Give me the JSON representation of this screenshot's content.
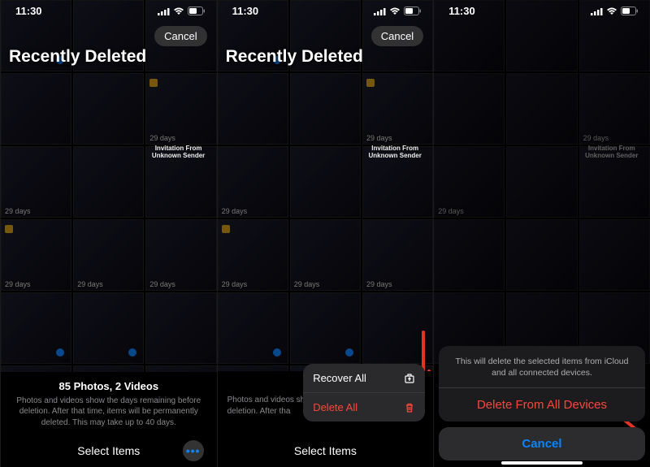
{
  "status": {
    "time": "11:30"
  },
  "header": {
    "title": "Recently Deleted",
    "cancel": "Cancel"
  },
  "grid": {
    "days_label": "29 days",
    "invitation_title": "Invitation From Unknown Sender"
  },
  "footer": {
    "summary_title": "85 Photos, 2 Videos",
    "summary_text": "Photos and videos show the days remaining before deletion. After that time, items will be permanently deleted. This may take up to 40 days.",
    "summary_text_short": "Photos and videos show the days remaining before deletion. After tha",
    "select_label": "Select Items"
  },
  "menu": {
    "recover": "Recover All",
    "delete": "Delete All"
  },
  "sheet": {
    "message": "This will delete the selected items from iCloud and all connected devices.",
    "action": "Delete From All Devices",
    "cancel": "Cancel"
  }
}
